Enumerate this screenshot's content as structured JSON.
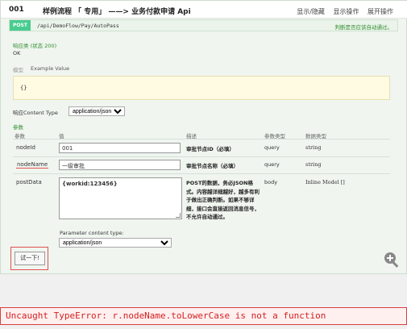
{
  "header": {
    "number": "001",
    "title": "样例流程 「    专用」 ——> 业务付款申请 Api",
    "actions": [
      "显示/隐藏",
      "显示操作",
      "展开操作"
    ]
  },
  "operation": {
    "method": "POST",
    "path": "/api/DemoFlow/Pay/AutoPass",
    "check_text": "判断是否应该自动通过。"
  },
  "response": {
    "heading": "响应类 (状态 200)",
    "status": "OK",
    "model_label": "模型",
    "example_label": "Example Value",
    "example_value": "{}",
    "content_type_label": "响应Content Type",
    "content_type_value": "application/json"
  },
  "parameters": {
    "heading": "参数",
    "columns": [
      "参数",
      "值",
      "描述",
      "参数类型",
      "数据类型"
    ],
    "rows": [
      {
        "name": "nodeId",
        "value": "001",
        "description": "审批节点ID（必填）",
        "param_type": "query",
        "data_type": "string"
      },
      {
        "name": "nodeName",
        "value": "一级审批",
        "description": "审批节点名称（必填）",
        "param_type": "query",
        "data_type": "string"
      },
      {
        "name": "postData",
        "value": "{workid:123456}",
        "description": "POST的数据，务必JSON格式。内容越详细越好，越多有利于做出正确判断。如果不够详细，接口会直接返回消息信号，不允许自动通过。",
        "param_type": "body",
        "data_type": "Inline Model []"
      }
    ],
    "param_content_type_label": "Parameter content type:",
    "param_content_type_value": "application/json"
  },
  "try_button": "试一下!",
  "error": "Uncaught TypeError: r.nodeName.toLowerCase is not a function",
  "colors": {
    "post_badge": "#49cc90",
    "error_red": "#d42020",
    "highlight_outline": "#e05050"
  }
}
